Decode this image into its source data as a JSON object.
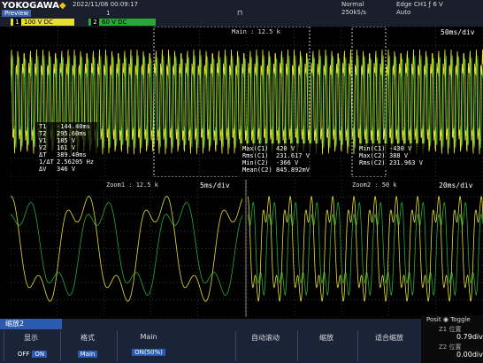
{
  "header": {
    "logo": "YOKOGAWA",
    "logo_diamond": "◆",
    "preview": "Preview",
    "datetime": "2022/11/08 00:09:17",
    "marker": "1",
    "acq_icon": "⊓",
    "acq_mode": "Normal",
    "sample_rate": "250kS/s",
    "trigger": "Edge CH1 ƒ 6 V",
    "trigger_mode": "Auto"
  },
  "channels": [
    {
      "num": "1",
      "label": "100 V",
      "coupling": "DC",
      "color": "#e8e030"
    },
    {
      "num": "2",
      "label": "60 V",
      "coupling": "DC",
      "color": "#28a838"
    }
  ],
  "main_window": {
    "zoom1_label": "Main : 12.5 k",
    "timebase": "50ms/div"
  },
  "cursor_readout": [
    {
      "name": "T1",
      "value": "-144.40ms"
    },
    {
      "name": "T2",
      "value": "295.60ms"
    },
    {
      "name": "V1",
      "value": "185 V"
    },
    {
      "name": "V2",
      "value": "161 V"
    },
    {
      "name": "ΔT",
      "value": "389.40ms"
    },
    {
      "name": "1/ΔT",
      "value": "2.56205 Hz"
    },
    {
      "name": "ΔV",
      "value": "346 V"
    }
  ],
  "measure_a": [
    {
      "name": "Max(C1)",
      "value": "420 V"
    },
    {
      "name": "Rms(C1)",
      "value": "231.617 V"
    },
    {
      "name": "Min(C2)",
      "value": "-366 V"
    },
    {
      "name": "Mean(C2)",
      "value": "845.892mV"
    }
  ],
  "measure_b": [
    {
      "name": "Min(C1)",
      "value": "-430 V"
    },
    {
      "name": "Max(C2)",
      "value": "388 V"
    },
    {
      "name": "Rms(C2)",
      "value": "231.963 V"
    }
  ],
  "zoom1": {
    "label": "Zoom1 : 12.5 k",
    "timebase": "5ms/div"
  },
  "zoom2": {
    "label": "Zoom2 : 50 k",
    "timebase": "20ms/div"
  },
  "softkeys": {
    "tab": "缩放2",
    "display_label": "显示",
    "display_off": "OFF",
    "display_on": "ON",
    "format_label": "格式",
    "format_value": "Main",
    "main_label": "Main",
    "main_value": "ON(50%)",
    "auto_scroll": "自动滚动",
    "scale": "缩放",
    "fit": "适合缩放"
  },
  "toggle": {
    "title": "Posit",
    "toggle_label": "Toggle",
    "z1_label": "Z1 位置",
    "z1_value": "0.79div",
    "z2_label": "Z2 位置",
    "z2_value": "0.00div"
  }
}
